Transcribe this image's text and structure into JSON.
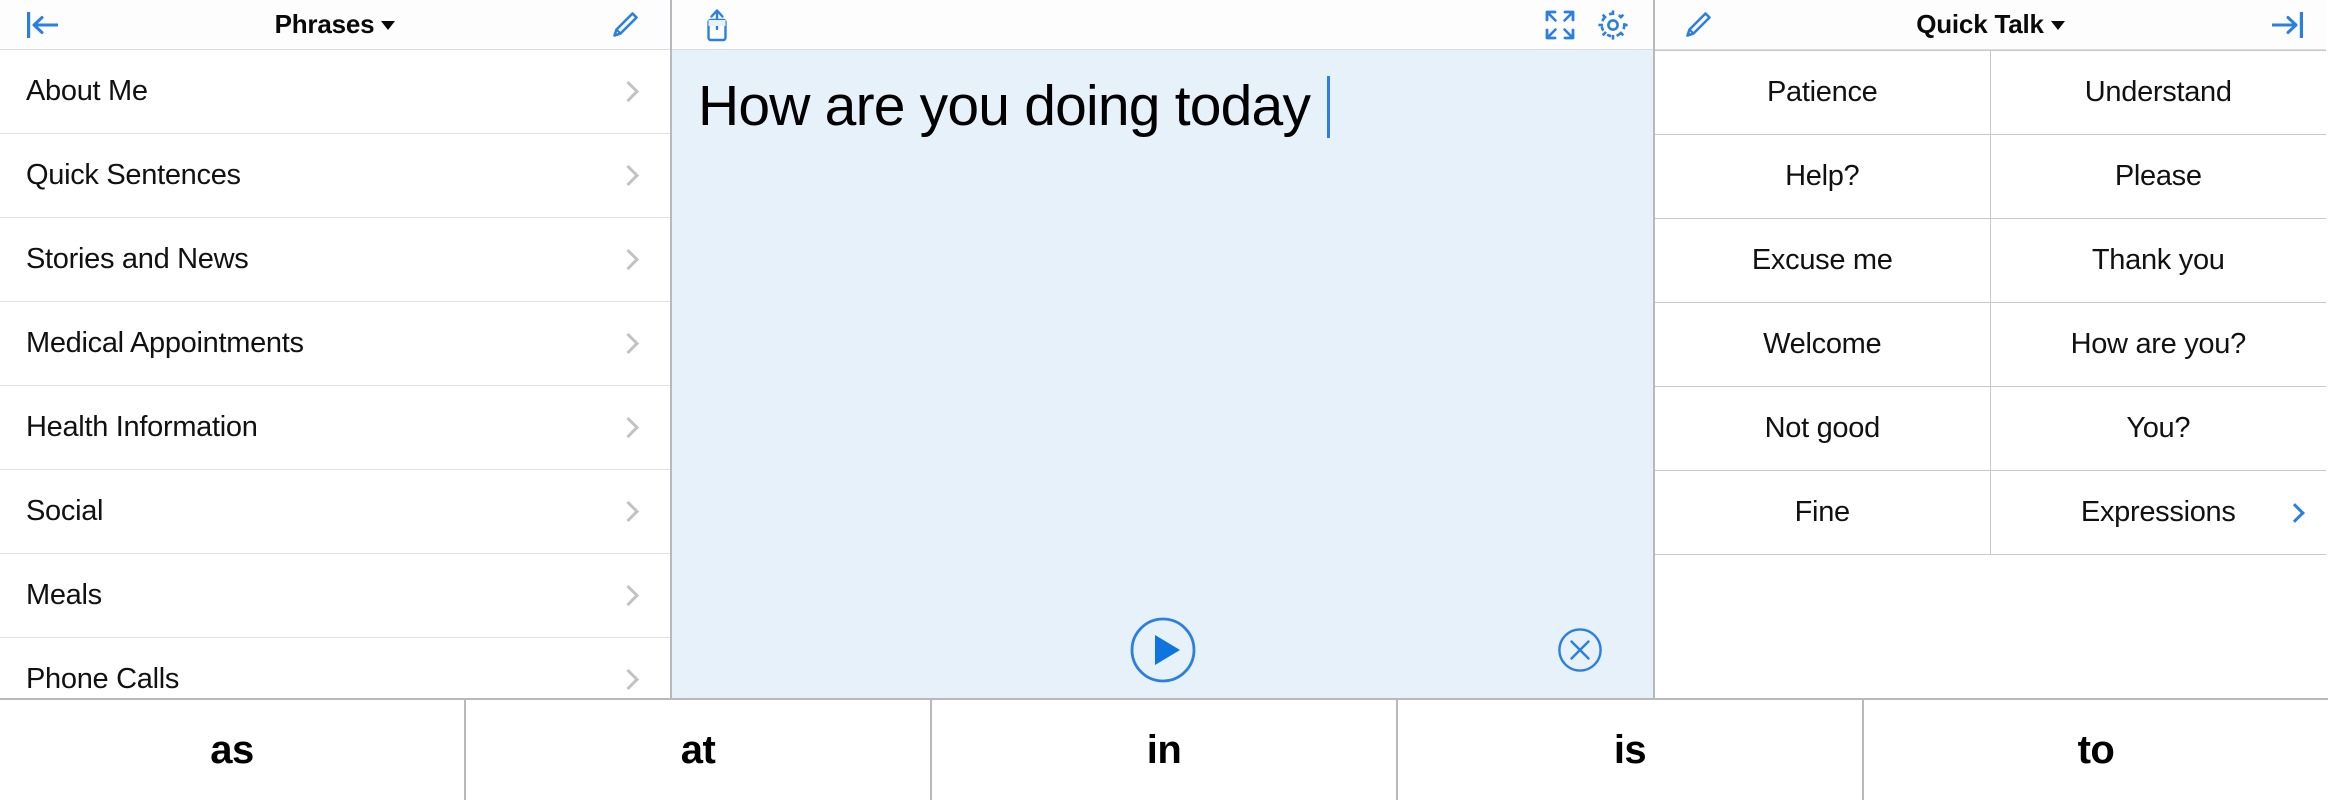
{
  "sidebar": {
    "header": {
      "title": "Phrases",
      "back_icon": "back-to-start-icon",
      "edit_icon": "pencil-edit-icon"
    },
    "items": [
      {
        "label": "About Me"
      },
      {
        "label": "Quick Sentences"
      },
      {
        "label": "Stories and News"
      },
      {
        "label": "Medical Appointments"
      },
      {
        "label": "Health Information"
      },
      {
        "label": "Social"
      },
      {
        "label": "Meals"
      },
      {
        "label": "Phone Calls"
      }
    ]
  },
  "center": {
    "toolbar": {
      "share_icon": "share-icon",
      "fullscreen_icon": "expand-fullscreen-icon",
      "settings_icon": "gear-icon"
    },
    "message": "How are you doing today ",
    "play_icon": "play-icon",
    "clear_icon": "clear-circle-x-icon"
  },
  "right": {
    "header": {
      "title": "Quick Talk",
      "edit_icon": "pencil-edit-icon",
      "collapse_icon": "collapse-right-icon"
    },
    "cells": [
      {
        "label": "Patience",
        "folder": false
      },
      {
        "label": "Understand",
        "folder": false
      },
      {
        "label": "Help?",
        "folder": false
      },
      {
        "label": "Please",
        "folder": false
      },
      {
        "label": "Excuse me",
        "folder": false
      },
      {
        "label": "Thank you",
        "folder": false
      },
      {
        "label": "Welcome",
        "folder": false
      },
      {
        "label": "How are you?",
        "folder": false
      },
      {
        "label": "Not good",
        "folder": false
      },
      {
        "label": "You?",
        "folder": false
      },
      {
        "label": "Fine",
        "folder": false
      },
      {
        "label": "Expressions",
        "folder": true
      }
    ]
  },
  "prediction_bar": {
    "words": [
      "as",
      "at",
      "in",
      "is",
      "to"
    ]
  },
  "colors": {
    "accent_blue": "#2b7fe0",
    "text_area_bg": "#e6f1fa",
    "divider": "#b9b9bd",
    "chevron_gray": "#c3c3c6"
  }
}
